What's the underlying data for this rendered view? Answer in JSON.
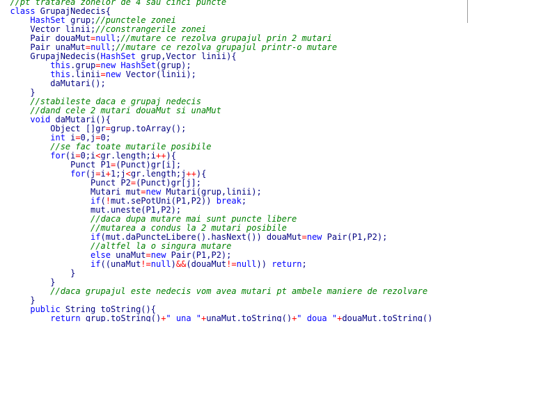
{
  "editor": {
    "lines": [
      [
        {
          "t": "cm",
          "v": "  //pt tratarea zonelor de 4 sau cinci puncte"
        }
      ],
      [
        {
          "t": "kw",
          "v": "  class"
        },
        {
          "t": "tx",
          "v": " GrupajNedecis{"
        }
      ],
      [
        {
          "t": "kw",
          "v": "      HashSet"
        },
        {
          "t": "tx",
          "v": " grup;"
        },
        {
          "t": "cm",
          "v": "//punctele zonei"
        }
      ],
      [
        {
          "t": "tx",
          "v": "      Vector linii;"
        },
        {
          "t": "cm",
          "v": "//constrangerile zonei"
        }
      ],
      [
        {
          "t": "tx",
          "v": "      Pair douaMut"
        },
        {
          "t": "op",
          "v": "="
        },
        {
          "t": "kw",
          "v": "null"
        },
        {
          "t": "tx",
          "v": ";"
        },
        {
          "t": "cm",
          "v": "//mutare ce rezolva grupajul prin 2 mutari"
        }
      ],
      [
        {
          "t": "tx",
          "v": "      Pair unaMut"
        },
        {
          "t": "op",
          "v": "="
        },
        {
          "t": "kw",
          "v": "null"
        },
        {
          "t": "tx",
          "v": ";"
        },
        {
          "t": "cm",
          "v": "//mutare ce rezolva grupajul printr-o mutare"
        }
      ],
      [
        {
          "t": "tx",
          "v": "      GrupajNedecis("
        },
        {
          "t": "kw",
          "v": "HashSet"
        },
        {
          "t": "tx",
          "v": " grup,Vector linii){"
        }
      ],
      [
        {
          "t": "kw",
          "v": "          this"
        },
        {
          "t": "tx",
          "v": ".grup"
        },
        {
          "t": "op",
          "v": "="
        },
        {
          "t": "kw",
          "v": "new"
        },
        {
          "t": "kw",
          "v": " HashSet"
        },
        {
          "t": "tx",
          "v": "(grup);"
        }
      ],
      [
        {
          "t": "kw",
          "v": "          this"
        },
        {
          "t": "tx",
          "v": ".linii"
        },
        {
          "t": "op",
          "v": "="
        },
        {
          "t": "kw",
          "v": "new"
        },
        {
          "t": "tx",
          "v": " Vector(linii);"
        }
      ],
      [
        {
          "t": "tx",
          "v": "          daMutari();"
        }
      ],
      [
        {
          "t": "tx",
          "v": "      }"
        }
      ],
      [
        {
          "t": "cm",
          "v": "      //stabileste daca e grupaj nedecis"
        }
      ],
      [
        {
          "t": "cm",
          "v": "      //dand cele 2 mutari douaMut si unaMut"
        }
      ],
      [
        {
          "t": "kw",
          "v": "      void"
        },
        {
          "t": "tx",
          "v": " daMutari(){"
        }
      ],
      [
        {
          "t": "tx",
          "v": "          Object []gr"
        },
        {
          "t": "op",
          "v": "="
        },
        {
          "t": "tx",
          "v": "grup.toArray();"
        }
      ],
      [
        {
          "t": "kw",
          "v": "          int"
        },
        {
          "t": "tx",
          "v": " i"
        },
        {
          "t": "op",
          "v": "="
        },
        {
          "t": "tx",
          "v": "0,j"
        },
        {
          "t": "op",
          "v": "="
        },
        {
          "t": "tx",
          "v": "0;"
        }
      ],
      [
        {
          "t": "cm",
          "v": "          //se fac toate mutarile posibile"
        }
      ],
      [
        {
          "t": "kw",
          "v": "          for"
        },
        {
          "t": "tx",
          "v": "(i"
        },
        {
          "t": "op",
          "v": "="
        },
        {
          "t": "tx",
          "v": "0;i"
        },
        {
          "t": "op",
          "v": "<"
        },
        {
          "t": "tx",
          "v": "gr.length;i"
        },
        {
          "t": "op",
          "v": "++"
        },
        {
          "t": "tx",
          "v": "){"
        }
      ],
      [
        {
          "t": "tx",
          "v": "              Punct P1"
        },
        {
          "t": "op",
          "v": "="
        },
        {
          "t": "tx",
          "v": "(Punct)gr[i];"
        }
      ],
      [
        {
          "t": "kw",
          "v": "              for"
        },
        {
          "t": "tx",
          "v": "(j"
        },
        {
          "t": "op",
          "v": "="
        },
        {
          "t": "tx",
          "v": "i"
        },
        {
          "t": "op",
          "v": "+"
        },
        {
          "t": "tx",
          "v": "1;j"
        },
        {
          "t": "op",
          "v": "<"
        },
        {
          "t": "tx",
          "v": "gr.length;j"
        },
        {
          "t": "op",
          "v": "++"
        },
        {
          "t": "tx",
          "v": "){"
        }
      ],
      [
        {
          "t": "tx",
          "v": "                  Punct P2"
        },
        {
          "t": "op",
          "v": "="
        },
        {
          "t": "tx",
          "v": "(Punct)gr[j];"
        }
      ],
      [
        {
          "t": "tx",
          "v": "                  Mutari mut"
        },
        {
          "t": "op",
          "v": "="
        },
        {
          "t": "kw",
          "v": "new"
        },
        {
          "t": "tx",
          "v": " Mutari(grup,linii);"
        }
      ],
      [
        {
          "t": "kw",
          "v": "                  if"
        },
        {
          "t": "tx",
          "v": "("
        },
        {
          "t": "op",
          "v": "!"
        },
        {
          "t": "tx",
          "v": "mut.sePotUni(P1,P2)) "
        },
        {
          "t": "kw",
          "v": "break"
        },
        {
          "t": "tx",
          "v": ";"
        }
      ],
      [
        {
          "t": "tx",
          "v": "                  mut.uneste(P1,P2);"
        }
      ],
      [
        {
          "t": "cm",
          "v": "                  //daca dupa mutare mai sunt puncte libere"
        }
      ],
      [
        {
          "t": "cm",
          "v": "                  //mutarea a condus la 2 mutari posibile"
        }
      ],
      [
        {
          "t": "kw",
          "v": "                  if"
        },
        {
          "t": "tx",
          "v": "(mut.daPuncteLibere().hasNext()) douaMut"
        },
        {
          "t": "op",
          "v": "="
        },
        {
          "t": "kw",
          "v": "new"
        },
        {
          "t": "tx",
          "v": " Pair(P1,P2);"
        }
      ],
      [
        {
          "t": "cm",
          "v": "                  //altfel la o singura mutare"
        }
      ],
      [
        {
          "t": "kw",
          "v": "                  else"
        },
        {
          "t": "tx",
          "v": " unaMut"
        },
        {
          "t": "op",
          "v": "="
        },
        {
          "t": "kw",
          "v": "new"
        },
        {
          "t": "tx",
          "v": " Pair(P1,P2);"
        }
      ],
      [
        {
          "t": "kw",
          "v": "                  if"
        },
        {
          "t": "tx",
          "v": "((unaMut"
        },
        {
          "t": "op",
          "v": "!="
        },
        {
          "t": "kw",
          "v": "null"
        },
        {
          "t": "tx",
          "v": ")"
        },
        {
          "t": "op",
          "v": "&&"
        },
        {
          "t": "tx",
          "v": "(douaMut"
        },
        {
          "t": "op",
          "v": "!="
        },
        {
          "t": "kw",
          "v": "null"
        },
        {
          "t": "tx",
          "v": ")) "
        },
        {
          "t": "kw",
          "v": "return"
        },
        {
          "t": "tx",
          "v": ";"
        }
      ],
      [
        {
          "t": "tx",
          "v": "              }"
        }
      ],
      [
        {
          "t": "tx",
          "v": "          }"
        }
      ],
      [
        {
          "t": "cm",
          "v": "          //daca grupajul este nedecis vom avea mutari pt ambele maniere de rezolvare"
        }
      ],
      [
        {
          "t": "tx",
          "v": "      }"
        }
      ],
      [
        {
          "t": "kw",
          "v": "      public"
        },
        {
          "t": "tx",
          "v": " String toString(){"
        }
      ],
      [
        {
          "t": "kw",
          "v": "          return"
        },
        {
          "t": "tx",
          "v": " grup.toString()"
        },
        {
          "t": "op",
          "v": "+"
        },
        {
          "t": "kw",
          "v": "\" una \""
        },
        {
          "t": "op",
          "v": "+"
        },
        {
          "t": "tx",
          "v": "unaMut.toString()"
        },
        {
          "t": "op",
          "v": "+"
        },
        {
          "t": "kw",
          "v": "\" doua \""
        },
        {
          "t": "op",
          "v": "+"
        },
        {
          "t": "tx",
          "v": "douaMut.toString()"
        }
      ]
    ]
  }
}
